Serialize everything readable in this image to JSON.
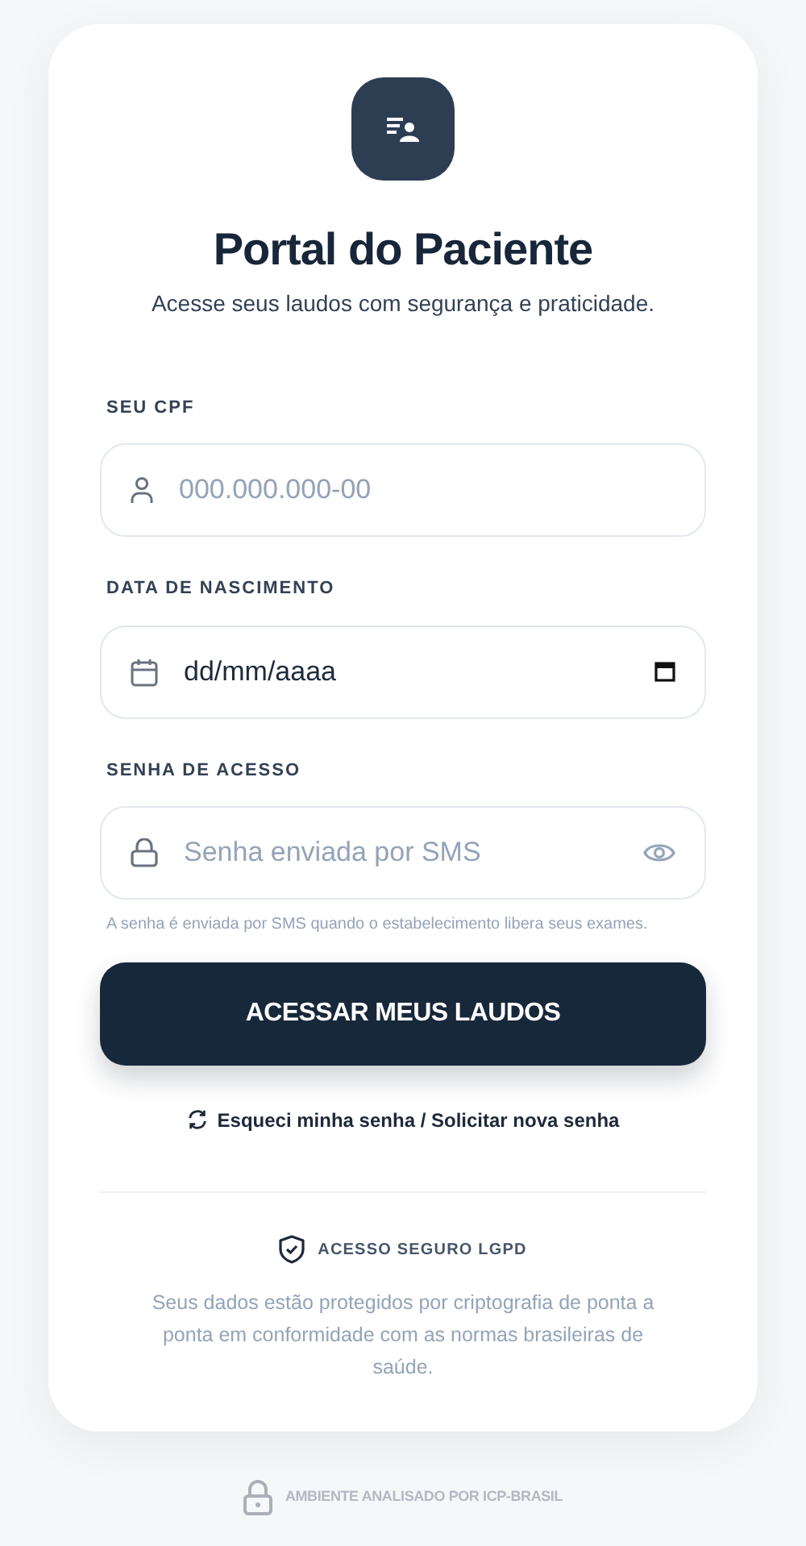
{
  "header": {
    "title": "Portal do Paciente",
    "subtitle": "Acesse seus laudos com segurança e praticidade."
  },
  "fields": [
    {
      "kind": "cpf",
      "label": "SEU CPF",
      "placeholder": "000.000.000-00"
    },
    {
      "kind": "date",
      "label": "DATA DE NASCIMENTO",
      "value": "dd/mm/aaaa"
    },
    {
      "kind": "password",
      "label": "SENHA DE ACESSO",
      "placeholder": "Senha enviada por SMS",
      "hint": "A senha é enviada por SMS quando o estabelecimento libera seus exames."
    }
  ],
  "submit_button": "ACESSAR MEUS LAUDOS",
  "forgot_link": "Esqueci minha senha / Solicitar nova senha",
  "security": {
    "title": "ACESSO SEGURO LGPD",
    "text": "Seus dados estão protegidos por criptografia de ponta a ponta em conformidade com as normas brasileiras de saúde."
  },
  "footer": "AMBIENTE ANALISADO POR ICP-BRASIL"
}
